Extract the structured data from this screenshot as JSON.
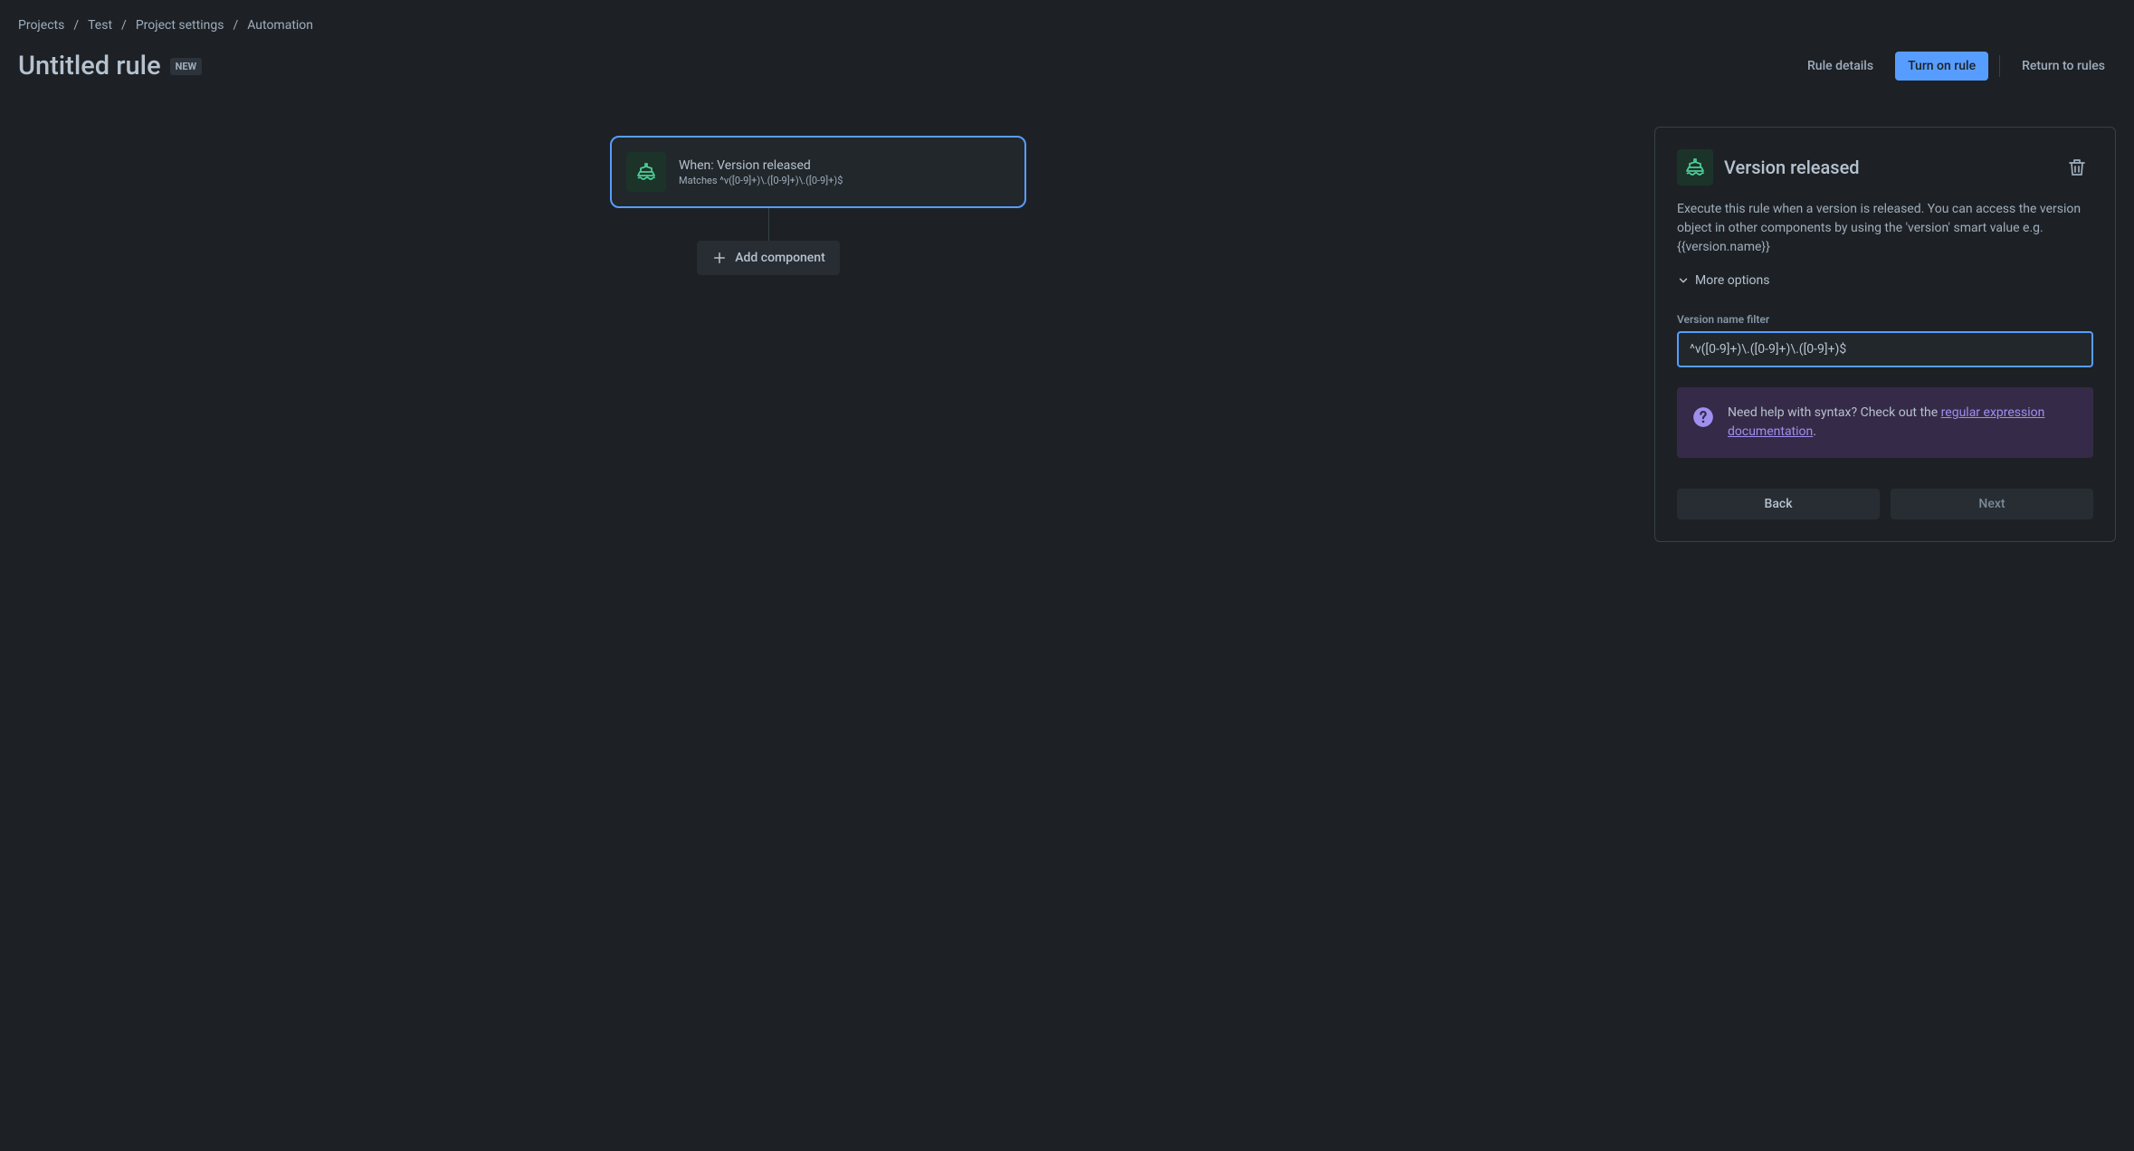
{
  "breadcrumbs": {
    "projects": "Projects",
    "test": "Test",
    "project_settings": "Project settings",
    "automation": "Automation"
  },
  "header": {
    "title": "Untitled rule",
    "badge": "NEW",
    "rule_details": "Rule details",
    "turn_on_rule": "Turn on rule",
    "return_to_rules": "Return to rules"
  },
  "flow": {
    "trigger_title": "When: Version released",
    "trigger_subtitle": "Matches ^v([0-9]+)\\.([0-9]+)\\.([0-9]+)$",
    "add_component": "Add component"
  },
  "config": {
    "title": "Version released",
    "description": "Execute this rule when a version is released. You can access the version object in other components by using the 'version' smart value e.g. {{version.name}}",
    "more_options": "More options",
    "field_label": "Version name filter",
    "field_value": "^v([0-9]+)\\.([0-9]+)\\.([0-9]+)$",
    "help_prefix": "Need help with syntax? Check out the ",
    "help_link": "regular expression documentation",
    "help_suffix": ".",
    "back": "Back",
    "next": "Next"
  }
}
